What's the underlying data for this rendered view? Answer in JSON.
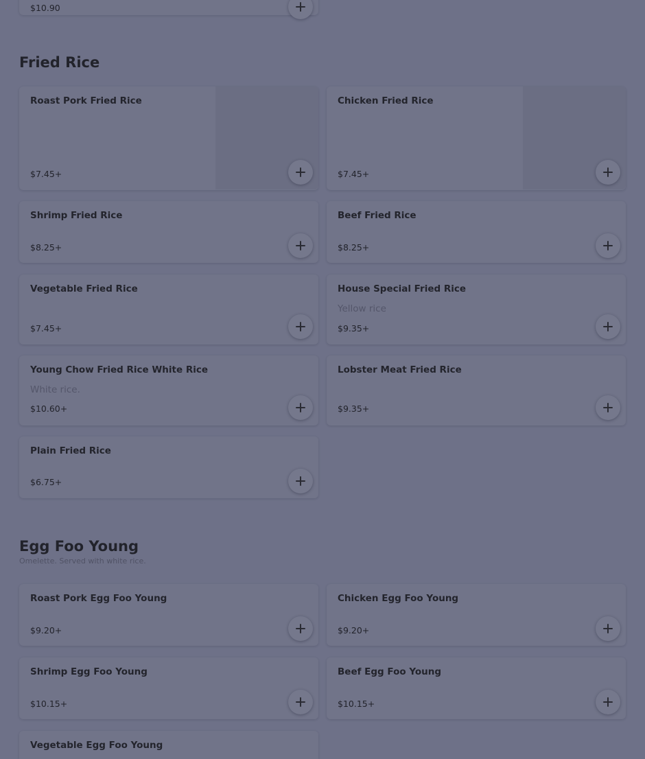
{
  "sections": [
    {
      "title": "Fried Rice",
      "items": [
        {
          "name": "Roast Pork Fried Rice",
          "price": "$7.45+"
        },
        {
          "name": "Chicken Fried Rice",
          "price": "$7.45+"
        },
        {
          "name": "Shrimp Fried Rice",
          "price": "$8.25+"
        },
        {
          "name": "Beef Fried Rice",
          "price": "$8.25+"
        },
        {
          "name": "Vegetable Fried Rice",
          "price": "$7.45+"
        },
        {
          "name": "House Special Fried Rice",
          "description": "Yellow rice",
          "price": "$9.35+"
        },
        {
          "name": "Young Chow Fried Rice White Rice",
          "description": "White rice.",
          "price": "$10.60+"
        },
        {
          "name": "Lobster Meat Fried Rice",
          "price": "$9.35+"
        },
        {
          "name": "Plain Fried Rice",
          "price": "$6.75+"
        }
      ]
    },
    {
      "title": "Egg Foo Young",
      "description": "Omelette. Served with white rice.",
      "items": [
        {
          "name": "Roast Pork Egg Foo Young",
          "price": "$9.20+"
        },
        {
          "name": "Chicken Egg Foo Young",
          "price": "$9.20+"
        },
        {
          "name": "Shrimp Egg Foo Young",
          "price": "$10.15+"
        },
        {
          "name": "Beef Egg Foo Young",
          "price": "$10.15+"
        },
        {
          "name": "Vegetable Egg Foo Young"
        }
      ]
    }
  ],
  "previous_item": {
    "price": "$10.90"
  },
  "icons": {
    "add": "plus-icon"
  },
  "colors": {
    "overlay": "#6e7188",
    "text": "#22232b"
  }
}
